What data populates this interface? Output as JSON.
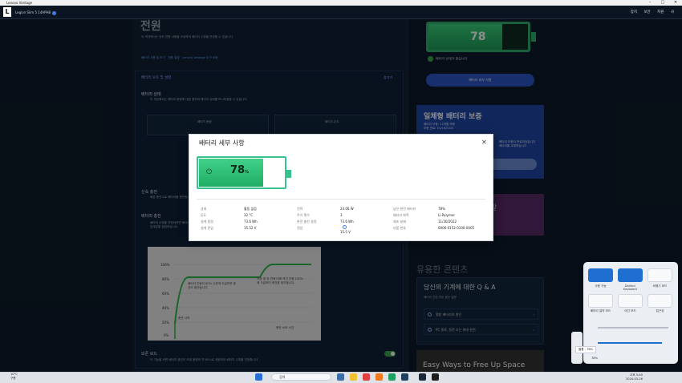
{
  "window": {
    "title": "Lenovo Vantage",
    "controls": [
      "–",
      "□",
      "✕"
    ]
  },
  "appbar": {
    "device_name": "Legion Slim 5 14APH8",
    "logo_letter": "L",
    "nav": [
      "장치",
      "보안",
      "지원",
      "사"
    ]
  },
  "page": {
    "heading": "전원",
    "intro": "이 섹션에서는 장치 전원 사용을 조정하여 배터리 수명을 연장할 수 있습니다.",
    "links": [
      "배터리 사용 팁 보기",
      "전원 설정",
      "Lenovo Vantage 도구 모음"
    ]
  },
  "battery_section": {
    "header": "배터리 보호 및 설정",
    "collapse_label": "숨기기",
    "status_title": "배터리 상태",
    "status_desc": "이 섹션에서는 배터리 용량에 대한 정보와 배터리 상태를 모니터링할 수 있습니다.",
    "card_left_label": "배터리 용량",
    "card_right_label": "배터리 온도",
    "fast_charge": "신속 충전",
    "fast_charge_desc": "빠른 충전으로 배터리를 충전합니다.",
    "conservation_title": "배터리 충전",
    "conservation_desc": "배터리 수명을 연장하려면 배터리 충전 임계값을 설정하십시오.",
    "chart_left_note": "배터리 잔량이 80% 수준에 도달하면 충전이 중단됩니다.",
    "chart_right_note": "저장 및 장 연에 대해 꺼진 전원 100%에 도달하여 충전을 중지합니다.",
    "chart_x_label": "충전 소요 시간",
    "chart_bottom_label": "충전 시작",
    "chart_ticks": [
      "100%",
      "80%",
      "60%",
      "40%",
      "20%",
      "0%"
    ],
    "save_mode": "보존 모드",
    "save_mode_desc": "이 기능을 켜면 배터리 충전이 최대 용량의 약 80%로 제한되어 배터리 수명을 연장합니다."
  },
  "right_column": {
    "battery_pct": "78",
    "battery_pct_unit": "%",
    "ok_text": "배터리 상태가 좋습니다",
    "detail_button": "배터리 세부 사항",
    "warranty_title": "일체형 배터리 보증",
    "warranty_lines": [
      "배터리 보증: 12개월 보증",
      "보증 만료: 01/16/2024"
    ],
    "warranty_right": [
      "배터리 보증이 만료되었습니다",
      "배터리를 교체하십시오"
    ],
    "pink_text": "말",
    "useful_title": "유용한 콘텐츠",
    "qa_title": "당신의 기계에 대한 Q & A",
    "qa_sub": "배터리 관련 자주 묻는 질문",
    "qa_rows": [
      "팽창 배터리의 원인",
      "PC 종료, 절전 또는 최대 절전"
    ],
    "promo_text": "Easy Ways to Free Up Space"
  },
  "dialog": {
    "title": "배터리 세부 사항",
    "close": "✕",
    "battery_pct": "78",
    "battery_unit": "%",
    "col1": [
      {
        "k": "상태",
        "v": "활동 없음"
      },
      {
        "k": "온도",
        "v": "32 °C"
      },
      {
        "k": "설계 용량",
        "v": "73.6 Wh"
      },
      {
        "k": "설계 전압",
        "v": "15.52 V"
      }
    ],
    "col1_values": [
      "활동 없음",
      "32 °C",
      "73.6 Wh",
      "15.52 V"
    ],
    "col2": [
      {
        "k": "전력",
        "v": "24.06 W"
      },
      {
        "k": "주기 횟수",
        "v": "3"
      },
      {
        "k": "완전 충전 용량",
        "v": "73.6 Wh"
      },
      {
        "k": "전압",
        "v": "15.5 V"
      }
    ],
    "col2_values": [
      "24.06 W",
      "3",
      "73.6 Wh",
      "15.5 V"
    ],
    "col3": [
      {
        "k": "남은 완전 배터리",
        "v": "78%"
      },
      {
        "k": "배터리 화학",
        "v": "Li-Polymer"
      },
      {
        "k": "제조 날짜",
        "v": "11/30/2022"
      },
      {
        "k": "부품 번호",
        "v": "0006-0152-0100-0005"
      }
    ],
    "col3_values": [
      "78%",
      "Li-Polymer",
      "11/30/2022",
      "0006-0152-0100-0005"
    ]
  },
  "quick_settings": {
    "tiles": [
      "사용 가능",
      "DaVinci Keyboard",
      "비행기 모드",
      "배터리 절약 모드",
      "야간 모드",
      "접근성"
    ],
    "volume_tooltip": "볼륨 : 78%",
    "battery_text": "78%"
  },
  "taskbar": {
    "weather_temp": "10°C",
    "weather_text": "구름",
    "search_placeholder": "검색",
    "time": "오후 5:40",
    "date": "2024-03-26"
  },
  "colors": {
    "accent_green": "#36c38d",
    "accent_blue": "#2a56c6",
    "warranty_blue": "#1f48a6"
  }
}
